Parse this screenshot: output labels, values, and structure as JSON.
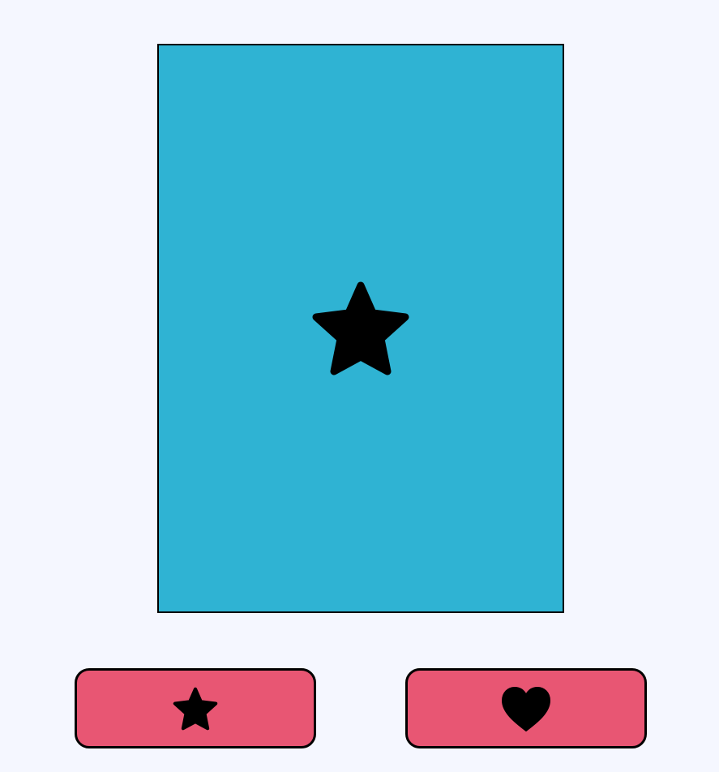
{
  "colors": {
    "background": "#f5f7ff",
    "card": "#2fb3d3",
    "button": "#e85673",
    "symbol": "#000000"
  },
  "card": {
    "symbol": "star-icon"
  },
  "choices": [
    {
      "icon": "star-icon"
    },
    {
      "icon": "heart-icon"
    }
  ]
}
